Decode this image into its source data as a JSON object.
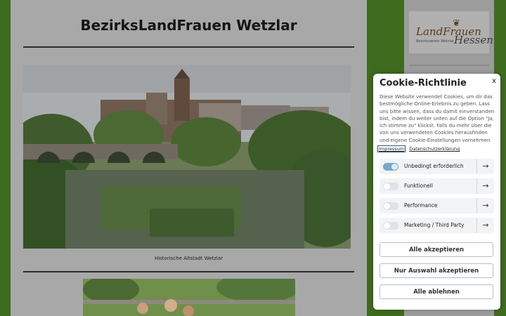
{
  "header": {
    "title": "BezirksLandFrauen Wetzlar"
  },
  "slider": {
    "caption": "Historische Altstadt Wetzlar",
    "next_icon": "›"
  },
  "sidebar": {
    "logo": {
      "brand": "LandFrauen",
      "region": "Hessen",
      "subtitle": "Bezirksverein Wetzlar"
    }
  },
  "cookie": {
    "title": "Cookie-Richtlinie",
    "close_label": "x",
    "text": "Diese Website verwendet Cookies, um dir das bestmögliche Online-Erlebnis zu geben. Lass uns bitte wissen, dass du damit einverstanden bist, indem du weiter unten auf die Option \"Ja, ich stimme zu\" klickst. Falls du mehr über die von uns verwendeten Cookies herausfinden und eigene Cookie-Einstellungen vornehmen",
    "links": {
      "impressum": "Impressum",
      "datenschutz": "Datenschutzerklärung"
    },
    "categories": [
      {
        "label": "Unbedingt erforderlich",
        "enabled": true
      },
      {
        "label": "Funktionell",
        "enabled": false
      },
      {
        "label": "Performance",
        "enabled": false
      },
      {
        "label": "Marketing / Third Party",
        "enabled": false
      }
    ],
    "arrow_icon": "→",
    "buttons": {
      "accept_all": "Alle akzeptieren",
      "accept_selection": "Nur Auswahl akzeptieren",
      "reject_all": "Alle ablehnen"
    }
  },
  "colors": {
    "page_background": "#3e6b1e",
    "toggle_on": "#7ba7c9"
  }
}
